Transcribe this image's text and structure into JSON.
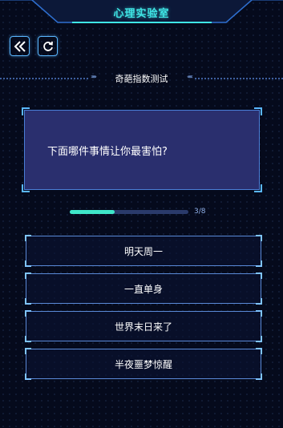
{
  "header": {
    "title": "心理实验室"
  },
  "nav": {
    "back_icon": "double-chevron-left-icon",
    "refresh_icon": "refresh-icon"
  },
  "section": {
    "title": "奇葩指数测试"
  },
  "question": {
    "text": "下面哪件事情让你最害怕?"
  },
  "progress": {
    "label": "3/8",
    "current": 3,
    "total": 8
  },
  "options": [
    {
      "label": "明天周一"
    },
    {
      "label": "一直单身"
    },
    {
      "label": "世界末日来了"
    },
    {
      "label": "半夜噩梦惊醒"
    }
  ],
  "colors": {
    "accent": "#3fe6e6",
    "border": "#5ab7ff",
    "card": "#2a2f6e",
    "background": "#050a1c"
  }
}
